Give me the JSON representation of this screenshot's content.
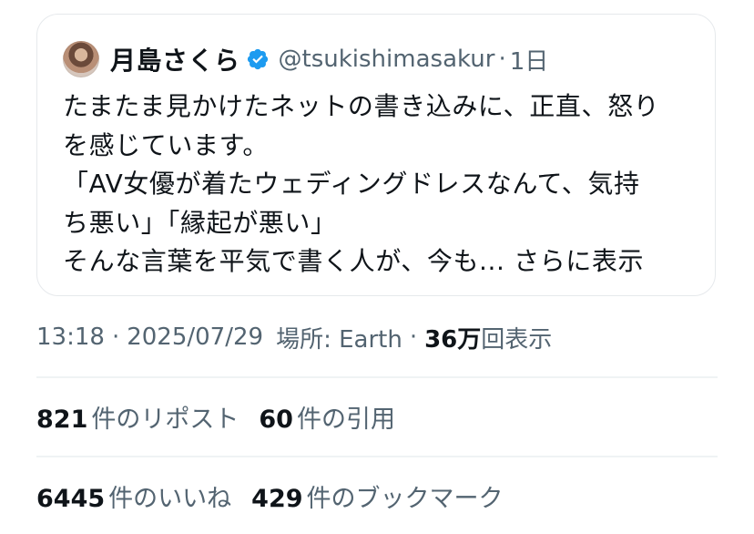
{
  "quote": {
    "display_name": "月島さくら",
    "handle": "@tsukishimasakur",
    "separator": "·",
    "time_ago": "1日",
    "verified_icon": "verified-badge-icon",
    "verified_color": "#1d9bf0",
    "lines": [
      "たまたま見かけたネットの書き込みに、正直、怒り",
      "を感じています。",
      "「AV女優が着たウェディングドレスなんて、気持",
      "ち悪い」「縁起が悪い」"
    ],
    "last_line": "そんな言葉を平気で書く人が、今も...",
    "show_more": "さらに表示"
  },
  "meta": {
    "time": "13:18",
    "sep1": "·",
    "date": "2025/07/29",
    "location_label": "場所: Earth",
    "sep2": "·",
    "views_count": "36万",
    "views_label": "回表示"
  },
  "stats": {
    "reposts_count": "821",
    "reposts_label": "件のリポスト",
    "quotes_count": "60",
    "quotes_label": "件の引用",
    "likes_count": "6445",
    "likes_label": "件のいいね",
    "bookmarks_count": "429",
    "bookmarks_label": "件のブックマーク"
  },
  "colors": {
    "text_primary": "#0f1419",
    "text_secondary": "#536471",
    "border": "#e6e9ec",
    "accent": "#1d9bf0"
  }
}
